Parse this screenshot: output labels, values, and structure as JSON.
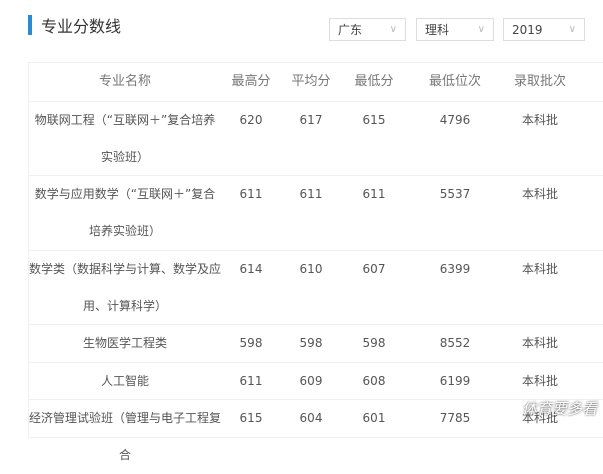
{
  "title": "专业分数线",
  "filters": {
    "province": "广东",
    "subject": "理科",
    "year": "2019"
  },
  "table": {
    "headers": [
      "专业名称",
      "最高分",
      "平均分",
      "最低分",
      "最低位次",
      "录取批次"
    ],
    "rows": [
      {
        "name": "物联网工程（“互联网＋”复合培养实验班）",
        "max": "620",
        "avg": "617",
        "min": "615",
        "rank": "4796",
        "batch": "本科批"
      },
      {
        "name": "数学与应用数学（“互联网＋”复合培养实验班）",
        "max": "611",
        "avg": "611",
        "min": "611",
        "rank": "5537",
        "batch": "本科批"
      },
      {
        "name": "数学类（数据科学与计算、数学及应用、计算科学）",
        "max": "614",
        "avg": "610",
        "min": "607",
        "rank": "6399",
        "batch": "本科批"
      },
      {
        "name": "生物医学工程类",
        "max": "598",
        "avg": "598",
        "min": "598",
        "rank": "8552",
        "batch": "本科批"
      },
      {
        "name": "人工智能",
        "max": "611",
        "avg": "609",
        "min": "608",
        "rank": "6199",
        "batch": "本科批"
      },
      {
        "name": "经济管理试验班（管理与电子工程复合",
        "max": "615",
        "avg": "604",
        "min": "601",
        "rank": "7785",
        "batch": "本科批"
      }
    ]
  },
  "watermark": "体育要多看"
}
